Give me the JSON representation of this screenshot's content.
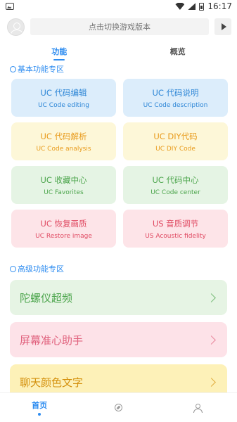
{
  "status": {
    "time": "16:17"
  },
  "topbar": {
    "search_placeholder": "点击切换游戏版本"
  },
  "tabs": [
    {
      "label": "功能"
    },
    {
      "label": "概览"
    }
  ],
  "basic": {
    "title": "基本功能专区",
    "cards": [
      {
        "title": "UC 代码编辑",
        "subtitle": "UC Code editing"
      },
      {
        "title": "UC 代码说明",
        "subtitle": "UC Code description"
      },
      {
        "title": "UC 代码解析",
        "subtitle": "UC Code analysis"
      },
      {
        "title": "UC DIY代码",
        "subtitle": "UC DIY Code"
      },
      {
        "title": "UC 收藏中心",
        "subtitle": "UC Favorites"
      },
      {
        "title": "UC 代码中心",
        "subtitle": "UC Code center"
      },
      {
        "title": "UC 恢复画质",
        "subtitle": "UC Restore image"
      },
      {
        "title": "US 音质调节",
        "subtitle": "US Acoustic fidelity"
      }
    ]
  },
  "advanced": {
    "title": "高级功能专区",
    "items": [
      {
        "label": "陀螺仪超频"
      },
      {
        "label": "屏幕准心助手"
      },
      {
        "label": "聊天颜色文字"
      }
    ]
  },
  "bottom_nav": {
    "home_label": "首页"
  },
  "colors": {
    "accent": "#2d8cf0",
    "blue": "#2d86d6",
    "yellow": "#e89a1a",
    "green": "#4ca54c",
    "pink": "#e04a62"
  }
}
